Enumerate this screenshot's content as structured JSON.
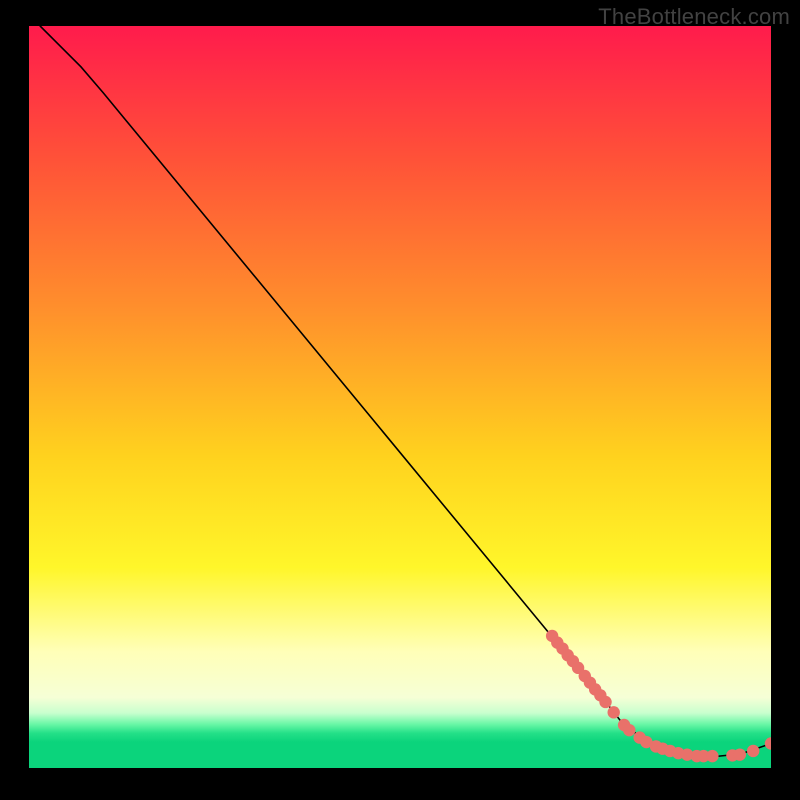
{
  "watermark": "TheBottleneck.com",
  "chart_data": {
    "type": "line",
    "title": "",
    "xlabel": "",
    "ylabel": "",
    "xlim": [
      0,
      100
    ],
    "ylim": [
      0,
      100
    ],
    "curve": [
      {
        "x": 1.5,
        "y": 100
      },
      {
        "x": 4.0,
        "y": 97.5
      },
      {
        "x": 7.0,
        "y": 94.5
      },
      {
        "x": 10.0,
        "y": 91.0
      },
      {
        "x": 77.5,
        "y": 9.2
      },
      {
        "x": 80.0,
        "y": 6.0
      },
      {
        "x": 84.0,
        "y": 3.0
      },
      {
        "x": 88.0,
        "y": 1.8
      },
      {
        "x": 92.0,
        "y": 1.5
      },
      {
        "x": 96.0,
        "y": 1.9
      },
      {
        "x": 100.0,
        "y": 3.3
      }
    ],
    "dot_cluster": [
      {
        "x": 70.5,
        "y": 17.8
      },
      {
        "x": 71.2,
        "y": 16.9
      },
      {
        "x": 71.9,
        "y": 16.1
      },
      {
        "x": 72.6,
        "y": 15.2
      },
      {
        "x": 73.3,
        "y": 14.4
      },
      {
        "x": 74.0,
        "y": 13.5
      },
      {
        "x": 74.9,
        "y": 12.4
      },
      {
        "x": 75.6,
        "y": 11.5
      },
      {
        "x": 76.3,
        "y": 10.6
      },
      {
        "x": 77.0,
        "y": 9.8
      },
      {
        "x": 77.7,
        "y": 8.9
      },
      {
        "x": 78.8,
        "y": 7.5
      },
      {
        "x": 80.2,
        "y": 5.8
      },
      {
        "x": 80.9,
        "y": 5.1
      },
      {
        "x": 82.3,
        "y": 4.1
      },
      {
        "x": 83.2,
        "y": 3.5
      },
      {
        "x": 84.5,
        "y": 2.9
      },
      {
        "x": 85.4,
        "y": 2.6
      },
      {
        "x": 86.4,
        "y": 2.3
      },
      {
        "x": 87.5,
        "y": 2.0
      },
      {
        "x": 88.7,
        "y": 1.8
      },
      {
        "x": 90.0,
        "y": 1.6
      },
      {
        "x": 90.9,
        "y": 1.6
      },
      {
        "x": 92.1,
        "y": 1.6
      },
      {
        "x": 94.8,
        "y": 1.7
      },
      {
        "x": 95.8,
        "y": 1.8
      },
      {
        "x": 97.6,
        "y": 2.3
      },
      {
        "x": 100.0,
        "y": 3.3
      }
    ],
    "colors": {
      "curve": "#000000",
      "dots": "#e9716a",
      "gradient_top": "#ff1b4c",
      "gradient_mid": "#fff62a",
      "gradient_bottom": "#0bd47c"
    }
  }
}
